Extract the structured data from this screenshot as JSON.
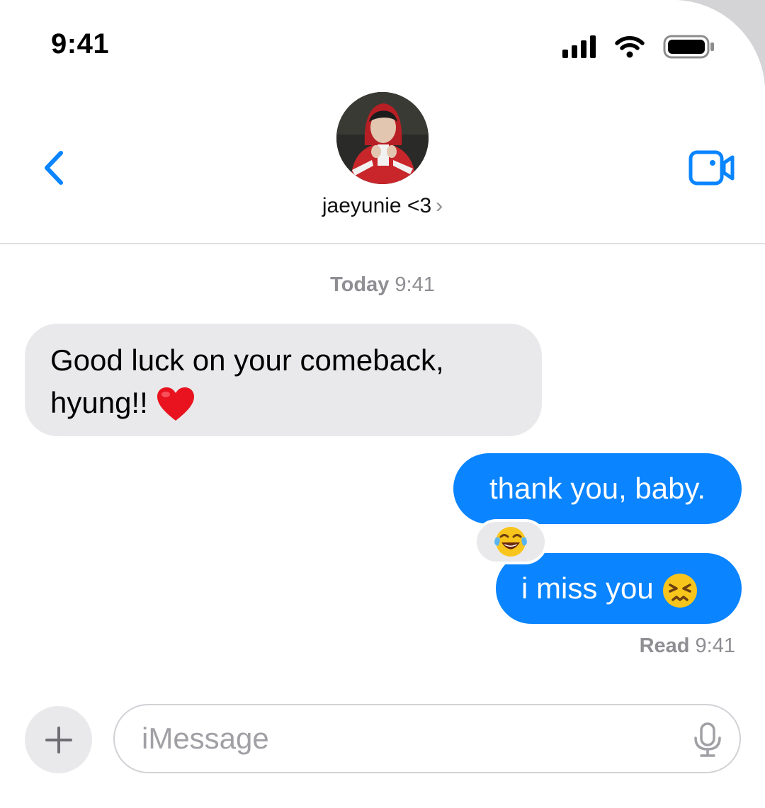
{
  "status": {
    "time": "9:41"
  },
  "header": {
    "contact_name": "jaeyunie <3",
    "chevron": "›"
  },
  "conversation": {
    "timestamp_day": "Today",
    "timestamp_time": "9:41",
    "messages": [
      {
        "from": "them",
        "text": "Good luck on your comeback,",
        "text2": "hyung!!",
        "emoji": "red-heart"
      },
      {
        "from": "me",
        "text": "thank you, baby.",
        "reaction": "face-with-tears-of-joy"
      },
      {
        "from": "me",
        "text": "i miss you",
        "emoji": "persevering-face"
      }
    ],
    "read_label": "Read",
    "read_time": "9:41"
  },
  "composer": {
    "placeholder": "iMessage"
  },
  "colors": {
    "accent": "#0a84ff",
    "incoming_bubble": "#e9e9eb",
    "muted_text": "#8e8e93"
  }
}
